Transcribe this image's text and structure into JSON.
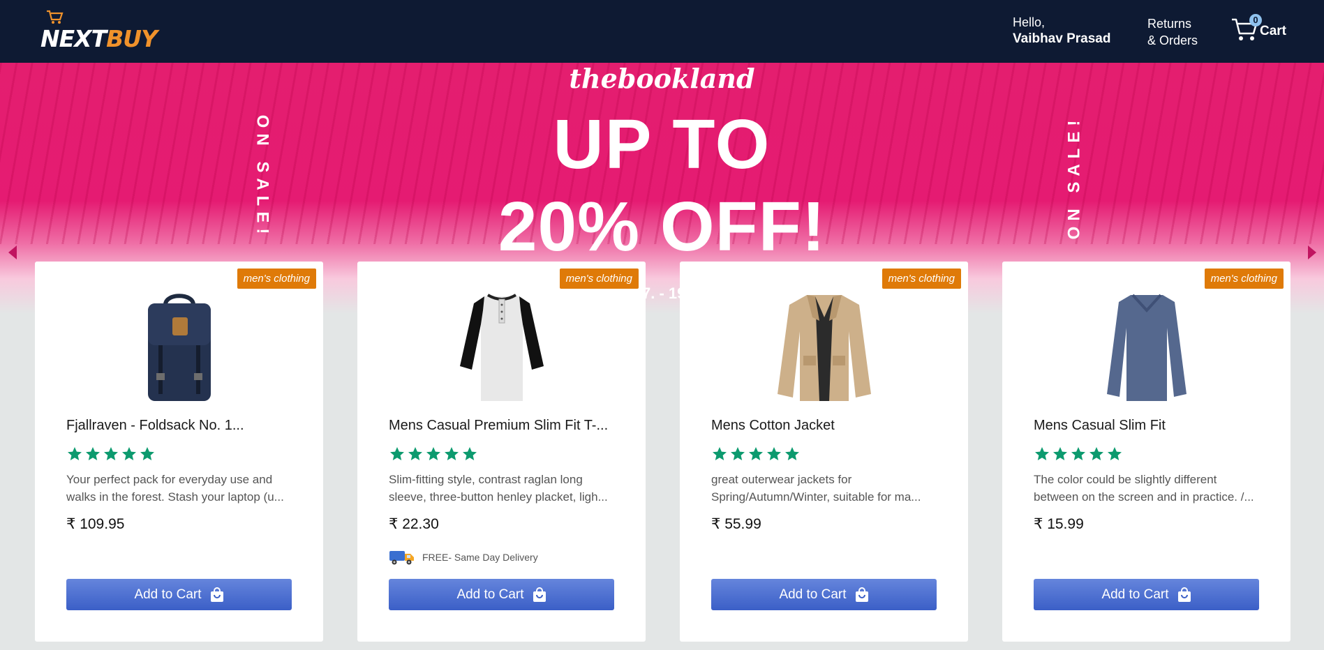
{
  "header": {
    "logo_next": "NEXT",
    "logo_buy": "BUY",
    "greeting": "Hello,",
    "user_name": "Vaibhav Prasad",
    "returns_line1": "Returns",
    "returns_line2": "& Orders",
    "cart_count": "0",
    "cart_label": "Cart"
  },
  "banner": {
    "brand": "thebookland",
    "line1": "UP TO",
    "line2": "20% OFF!",
    "side_left": "ON SALE!",
    "side_right": "ON SALE!",
    "date_fragment": "7. - 19"
  },
  "products": [
    {
      "category": "men's clothing",
      "title": "Fjallraven - Foldsack No. 1...",
      "desc_line1": "Your perfect pack for everyday use and",
      "desc_line2": "walks in the forest. Stash your laptop (u...",
      "price": "₹ 109.95",
      "button": "Add to Cart",
      "image_icon": "backpack-image"
    },
    {
      "category": "men's clothing",
      "title": "Mens Casual Premium Slim Fit T-...",
      "desc_line1": "Slim-fitting style, contrast raglan long",
      "desc_line2": "sleeve, three-button henley placket, ligh...",
      "price": "₹ 22.30",
      "delivery": "FREE- Same Day Delivery",
      "button": "Add to Cart",
      "image_icon": "tshirt-image"
    },
    {
      "category": "men's clothing",
      "title": "Mens Cotton Jacket",
      "desc_line1": "great outerwear jackets for",
      "desc_line2": "Spring/Autumn/Winter, suitable for ma...",
      "price": "₹ 55.99",
      "button": "Add to Cart",
      "image_icon": "jacket-image"
    },
    {
      "category": "men's clothing",
      "title": "Mens Casual Slim Fit",
      "desc_line1": "The color could be slightly different",
      "desc_line2": "between on the screen and in practice. /...",
      "price": "₹ 15.99",
      "button": "Add to Cart",
      "image_icon": "sweater-image"
    }
  ],
  "colors": {
    "header_bg": "#0e1a33",
    "accent_orange": "#f0922b",
    "badge_bg": "#df7a08",
    "star_green": "#0c9a6e",
    "button_blue": "#3b5fc7",
    "banner_pink": "#e41e6f"
  },
  "rating_stars": 5
}
